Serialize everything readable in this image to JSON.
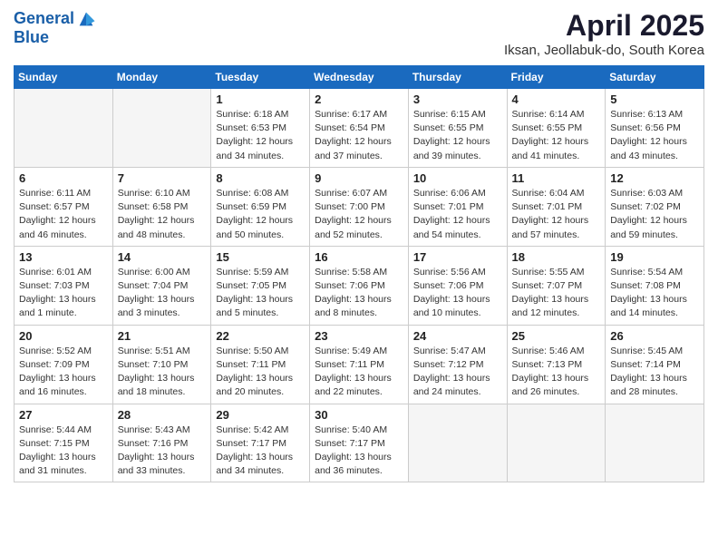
{
  "header": {
    "logo_line1": "General",
    "logo_line2": "Blue",
    "month": "April 2025",
    "location": "Iksan, Jeollabuk-do, South Korea"
  },
  "weekdays": [
    "Sunday",
    "Monday",
    "Tuesday",
    "Wednesday",
    "Thursday",
    "Friday",
    "Saturday"
  ],
  "weeks": [
    [
      {
        "day": "",
        "info": ""
      },
      {
        "day": "",
        "info": ""
      },
      {
        "day": "1",
        "info": "Sunrise: 6:18 AM\nSunset: 6:53 PM\nDaylight: 12 hours\nand 34 minutes."
      },
      {
        "day": "2",
        "info": "Sunrise: 6:17 AM\nSunset: 6:54 PM\nDaylight: 12 hours\nand 37 minutes."
      },
      {
        "day": "3",
        "info": "Sunrise: 6:15 AM\nSunset: 6:55 PM\nDaylight: 12 hours\nand 39 minutes."
      },
      {
        "day": "4",
        "info": "Sunrise: 6:14 AM\nSunset: 6:55 PM\nDaylight: 12 hours\nand 41 minutes."
      },
      {
        "day": "5",
        "info": "Sunrise: 6:13 AM\nSunset: 6:56 PM\nDaylight: 12 hours\nand 43 minutes."
      }
    ],
    [
      {
        "day": "6",
        "info": "Sunrise: 6:11 AM\nSunset: 6:57 PM\nDaylight: 12 hours\nand 46 minutes."
      },
      {
        "day": "7",
        "info": "Sunrise: 6:10 AM\nSunset: 6:58 PM\nDaylight: 12 hours\nand 48 minutes."
      },
      {
        "day": "8",
        "info": "Sunrise: 6:08 AM\nSunset: 6:59 PM\nDaylight: 12 hours\nand 50 minutes."
      },
      {
        "day": "9",
        "info": "Sunrise: 6:07 AM\nSunset: 7:00 PM\nDaylight: 12 hours\nand 52 minutes."
      },
      {
        "day": "10",
        "info": "Sunrise: 6:06 AM\nSunset: 7:01 PM\nDaylight: 12 hours\nand 54 minutes."
      },
      {
        "day": "11",
        "info": "Sunrise: 6:04 AM\nSunset: 7:01 PM\nDaylight: 12 hours\nand 57 minutes."
      },
      {
        "day": "12",
        "info": "Sunrise: 6:03 AM\nSunset: 7:02 PM\nDaylight: 12 hours\nand 59 minutes."
      }
    ],
    [
      {
        "day": "13",
        "info": "Sunrise: 6:01 AM\nSunset: 7:03 PM\nDaylight: 13 hours\nand 1 minute."
      },
      {
        "day": "14",
        "info": "Sunrise: 6:00 AM\nSunset: 7:04 PM\nDaylight: 13 hours\nand 3 minutes."
      },
      {
        "day": "15",
        "info": "Sunrise: 5:59 AM\nSunset: 7:05 PM\nDaylight: 13 hours\nand 5 minutes."
      },
      {
        "day": "16",
        "info": "Sunrise: 5:58 AM\nSunset: 7:06 PM\nDaylight: 13 hours\nand 8 minutes."
      },
      {
        "day": "17",
        "info": "Sunrise: 5:56 AM\nSunset: 7:06 PM\nDaylight: 13 hours\nand 10 minutes."
      },
      {
        "day": "18",
        "info": "Sunrise: 5:55 AM\nSunset: 7:07 PM\nDaylight: 13 hours\nand 12 minutes."
      },
      {
        "day": "19",
        "info": "Sunrise: 5:54 AM\nSunset: 7:08 PM\nDaylight: 13 hours\nand 14 minutes."
      }
    ],
    [
      {
        "day": "20",
        "info": "Sunrise: 5:52 AM\nSunset: 7:09 PM\nDaylight: 13 hours\nand 16 minutes."
      },
      {
        "day": "21",
        "info": "Sunrise: 5:51 AM\nSunset: 7:10 PM\nDaylight: 13 hours\nand 18 minutes."
      },
      {
        "day": "22",
        "info": "Sunrise: 5:50 AM\nSunset: 7:11 PM\nDaylight: 13 hours\nand 20 minutes."
      },
      {
        "day": "23",
        "info": "Sunrise: 5:49 AM\nSunset: 7:11 PM\nDaylight: 13 hours\nand 22 minutes."
      },
      {
        "day": "24",
        "info": "Sunrise: 5:47 AM\nSunset: 7:12 PM\nDaylight: 13 hours\nand 24 minutes."
      },
      {
        "day": "25",
        "info": "Sunrise: 5:46 AM\nSunset: 7:13 PM\nDaylight: 13 hours\nand 26 minutes."
      },
      {
        "day": "26",
        "info": "Sunrise: 5:45 AM\nSunset: 7:14 PM\nDaylight: 13 hours\nand 28 minutes."
      }
    ],
    [
      {
        "day": "27",
        "info": "Sunrise: 5:44 AM\nSunset: 7:15 PM\nDaylight: 13 hours\nand 31 minutes."
      },
      {
        "day": "28",
        "info": "Sunrise: 5:43 AM\nSunset: 7:16 PM\nDaylight: 13 hours\nand 33 minutes."
      },
      {
        "day": "29",
        "info": "Sunrise: 5:42 AM\nSunset: 7:17 PM\nDaylight: 13 hours\nand 34 minutes."
      },
      {
        "day": "30",
        "info": "Sunrise: 5:40 AM\nSunset: 7:17 PM\nDaylight: 13 hours\nand 36 minutes."
      },
      {
        "day": "",
        "info": ""
      },
      {
        "day": "",
        "info": ""
      },
      {
        "day": "",
        "info": ""
      }
    ]
  ]
}
